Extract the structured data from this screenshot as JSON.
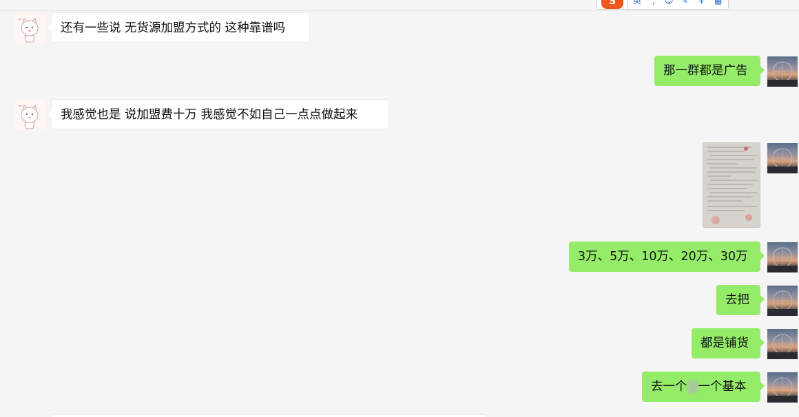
{
  "ime_toolbar": {
    "logo": "S",
    "icons": [
      "english-mode-icon",
      "punctuation-icon",
      "emoji-icon",
      "handwriting-icon",
      "voice-icon",
      "toolbox-icon"
    ],
    "accent_color": "#f2561d"
  },
  "chat": {
    "messages": [
      {
        "side": "left",
        "text": "还有一些说  无货源加盟方式的   这种靠谱吗"
      },
      {
        "side": "right",
        "text": "那一群都是广告"
      },
      {
        "side": "left",
        "text": "我感觉也是   说加盟费十万   我感觉不如自己一点点做起来"
      },
      {
        "side": "right",
        "type": "image"
      },
      {
        "side": "right",
        "text": "3万、5万、10万、20万、30万"
      },
      {
        "side": "right",
        "text": "去把"
      },
      {
        "side": "right",
        "text": "都是铺货"
      },
      {
        "side": "right",
        "text_before": "去一个",
        "text_after": "一个基本"
      }
    ]
  },
  "colors": {
    "self_bubble": "#95ec69",
    "other_bubble": "#ffffff",
    "background": "#f5f5f5"
  }
}
